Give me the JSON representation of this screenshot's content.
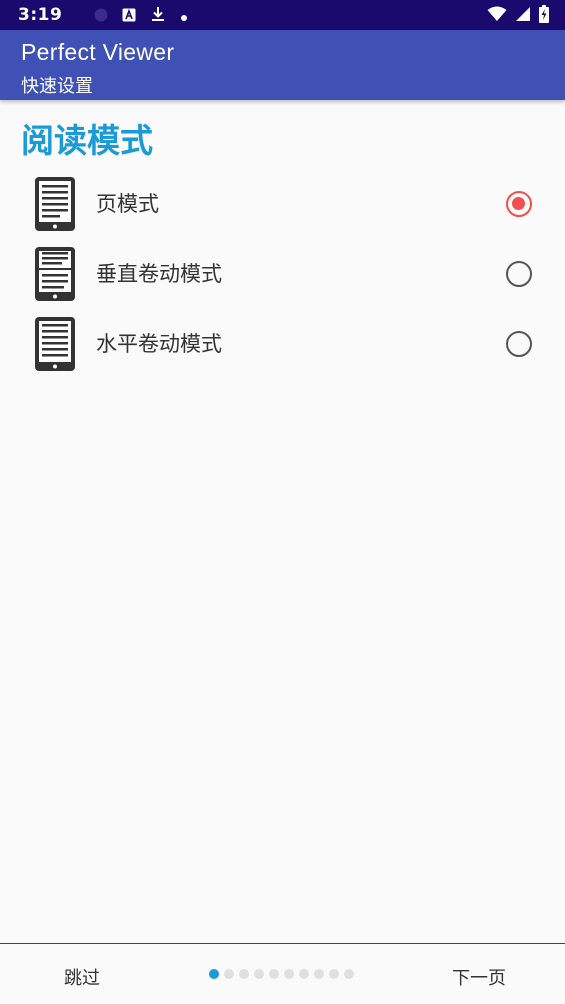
{
  "status_bar": {
    "time": "3:19"
  },
  "app_bar": {
    "title": "Perfect Viewer",
    "subtitle": "快速设置"
  },
  "section": {
    "title": "阅读模式"
  },
  "options": [
    {
      "label": "页模式",
      "icon": "page-mode-icon",
      "selected": true
    },
    {
      "label": "垂直卷动模式",
      "icon": "vertical-scroll-icon",
      "selected": false
    },
    {
      "label": "水平卷动模式",
      "icon": "horizontal-scroll-icon",
      "selected": false
    }
  ],
  "bottom_bar": {
    "skip_label": "跳过",
    "next_label": "下一页",
    "page_count": 10,
    "current_page": 1
  },
  "colors": {
    "status_bar": "#1a0a6e",
    "app_bar": "#3f51b5",
    "accent": "#1a9ad6",
    "radio_selected": "#ef4f4f"
  }
}
